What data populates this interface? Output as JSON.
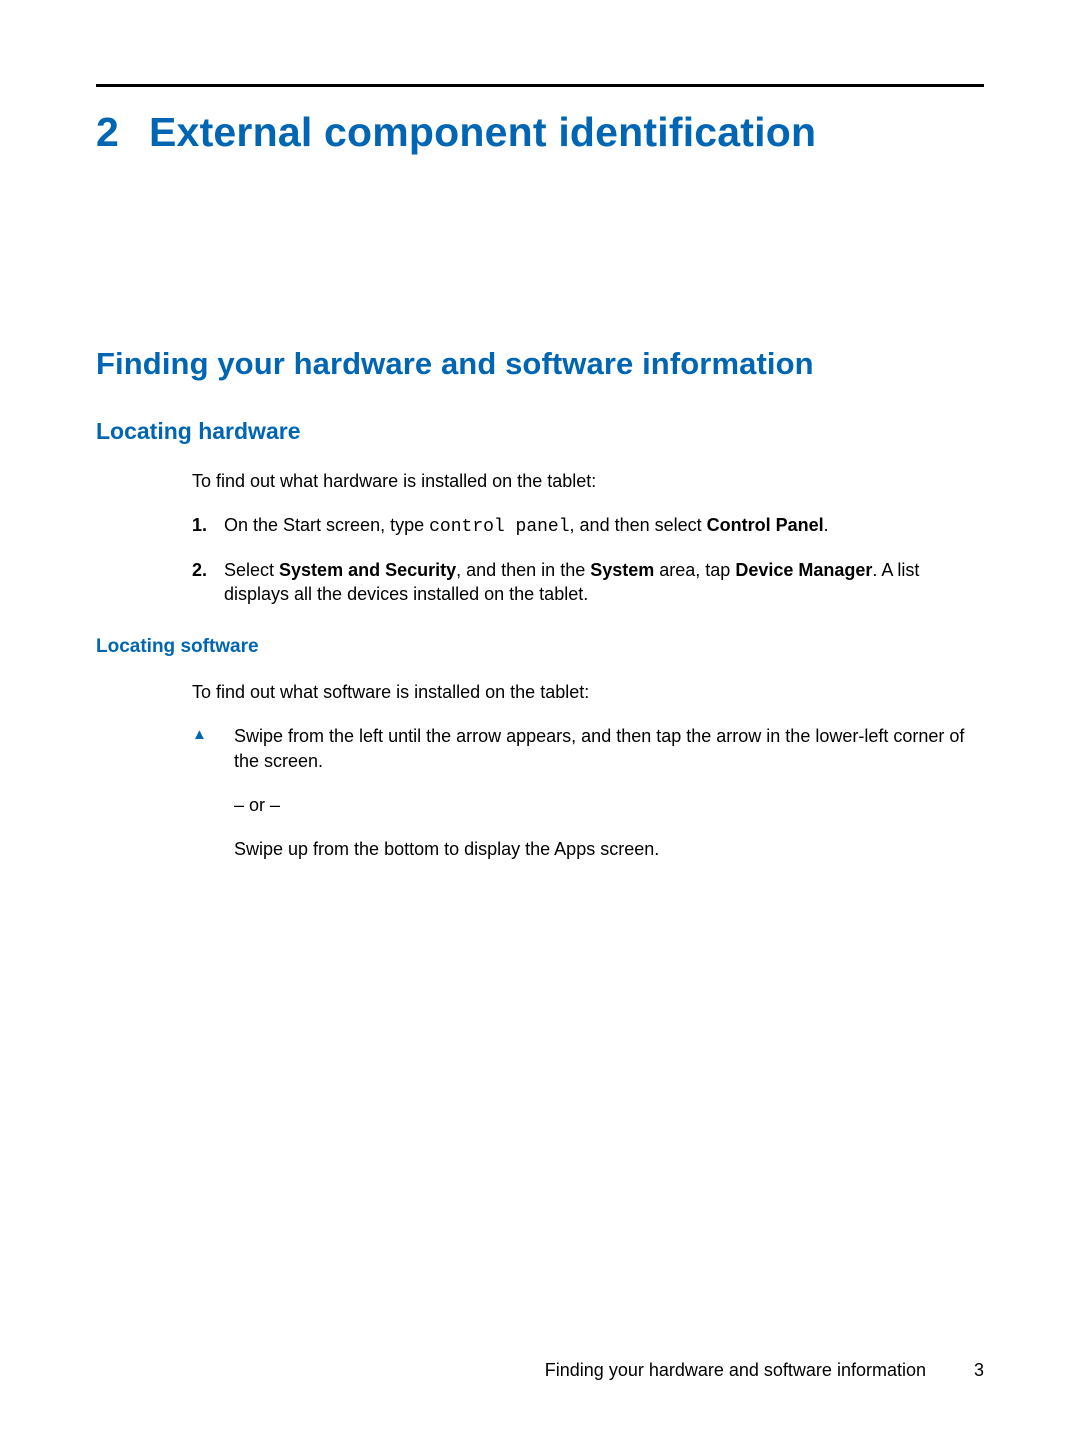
{
  "chapter": {
    "number": "2",
    "title": "External component identification"
  },
  "h2": "Finding your hardware and software information",
  "hw": {
    "heading": "Locating hardware",
    "intro": "To find out what hardware is installed on the tablet:",
    "step1": {
      "num": "1.",
      "pre": "On the Start screen, type ",
      "code": "control panel",
      "mid": ", and then select ",
      "bold": "Control Panel",
      "post": "."
    },
    "step2": {
      "num": "2.",
      "pre": "Select ",
      "b1": "System and Security",
      "mid1": ", and then in the ",
      "b2": "System",
      "mid2": " area, tap ",
      "b3": "Device Manager",
      "post": ". A list displays all the devices installed on the tablet."
    }
  },
  "sw": {
    "heading": "Locating software",
    "intro": "To find out what software is installed on the tablet:",
    "bullet1": "Swipe from the left until the arrow appears, and then tap the arrow in the lower-left corner of the screen.",
    "or": "– or –",
    "bullet2": "Swipe up from the bottom to display the Apps screen."
  },
  "footer": {
    "label": "Finding your hardware and software information",
    "page": "3"
  }
}
